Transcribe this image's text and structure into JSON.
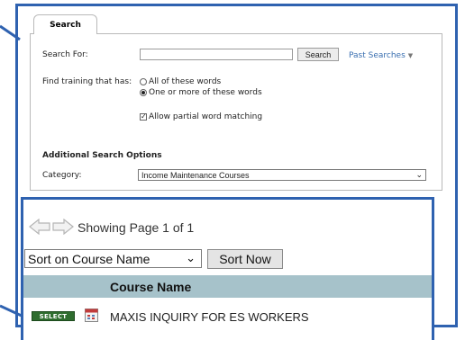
{
  "search_tab": {
    "label": "Search"
  },
  "search_form": {
    "search_for_label": "Search For:",
    "search_input_value": "",
    "search_button_label": "Search",
    "past_searches_label": "Past Searches",
    "find_training_label": "Find training that has:",
    "radio_all_label": "All of these words",
    "radio_one_label": "One or more of these words",
    "radio_selected": "One or more of these words",
    "partial_match_label": "Allow partial word matching",
    "partial_match_checked": true
  },
  "additional_options": {
    "heading": "Additional Search Options",
    "category_label": "Category:",
    "category_value": "Income Maintenance Courses"
  },
  "results": {
    "showing_text": "Showing Page 1 of 1",
    "sort_select_value": "Sort on Course Name",
    "sort_button_label": "Sort Now",
    "column_header": "Course Name",
    "rows": [
      {
        "select_label": "SELECT",
        "course_name": "MAXIS INQUIRY FOR ES WORKERS"
      }
    ]
  },
  "colors": {
    "callout_border": "#2f62b0",
    "table_header_bg": "#a6c2ca",
    "select_badge_bg": "#2f6d2f"
  },
  "icons": [
    "arrow-left-icon",
    "arrow-right-icon",
    "dropdown-chevron-icon",
    "course-calendar-icon"
  ]
}
